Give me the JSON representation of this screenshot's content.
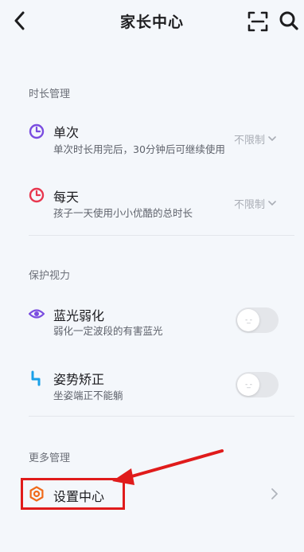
{
  "header": {
    "title": "家长中心"
  },
  "sections": {
    "duration": {
      "label": "时长管理",
      "single": {
        "title": "单次",
        "desc": "单次时长用完后，30分钟后可继续使用",
        "value": "不限制"
      },
      "daily": {
        "title": "每天",
        "desc": "孩子一天使用小小优酷的总时长",
        "value": "不限制"
      }
    },
    "eyes": {
      "label": "保护视力",
      "bluelight": {
        "title": "蓝光弱化",
        "desc": "弱化一定波段的有害蓝光",
        "toggle_on": false,
        "knob_text": "-_-"
      },
      "posture": {
        "title": "姿势矫正",
        "desc": "坐姿端正不能躺",
        "toggle_on": false,
        "knob_text": "-_-"
      }
    },
    "more": {
      "label": "更多管理",
      "settings": {
        "title": "设置中心"
      }
    }
  },
  "colors": {
    "background": "#f4f7fb",
    "accent_purple": "#7a4de0",
    "accent_red": "#e8374f",
    "accent_blue": "#1aa0e8",
    "accent_orange": "#f06a1a",
    "annotation_red": "#e01b1b"
  },
  "icons": {
    "back": "chevron-left-icon",
    "scan": "scan-icon",
    "search": "search-icon",
    "single": "clock-icon",
    "daily": "clock-icon",
    "bluelight": "eye-icon",
    "posture": "posture-icon",
    "settings": "gear-icon"
  }
}
